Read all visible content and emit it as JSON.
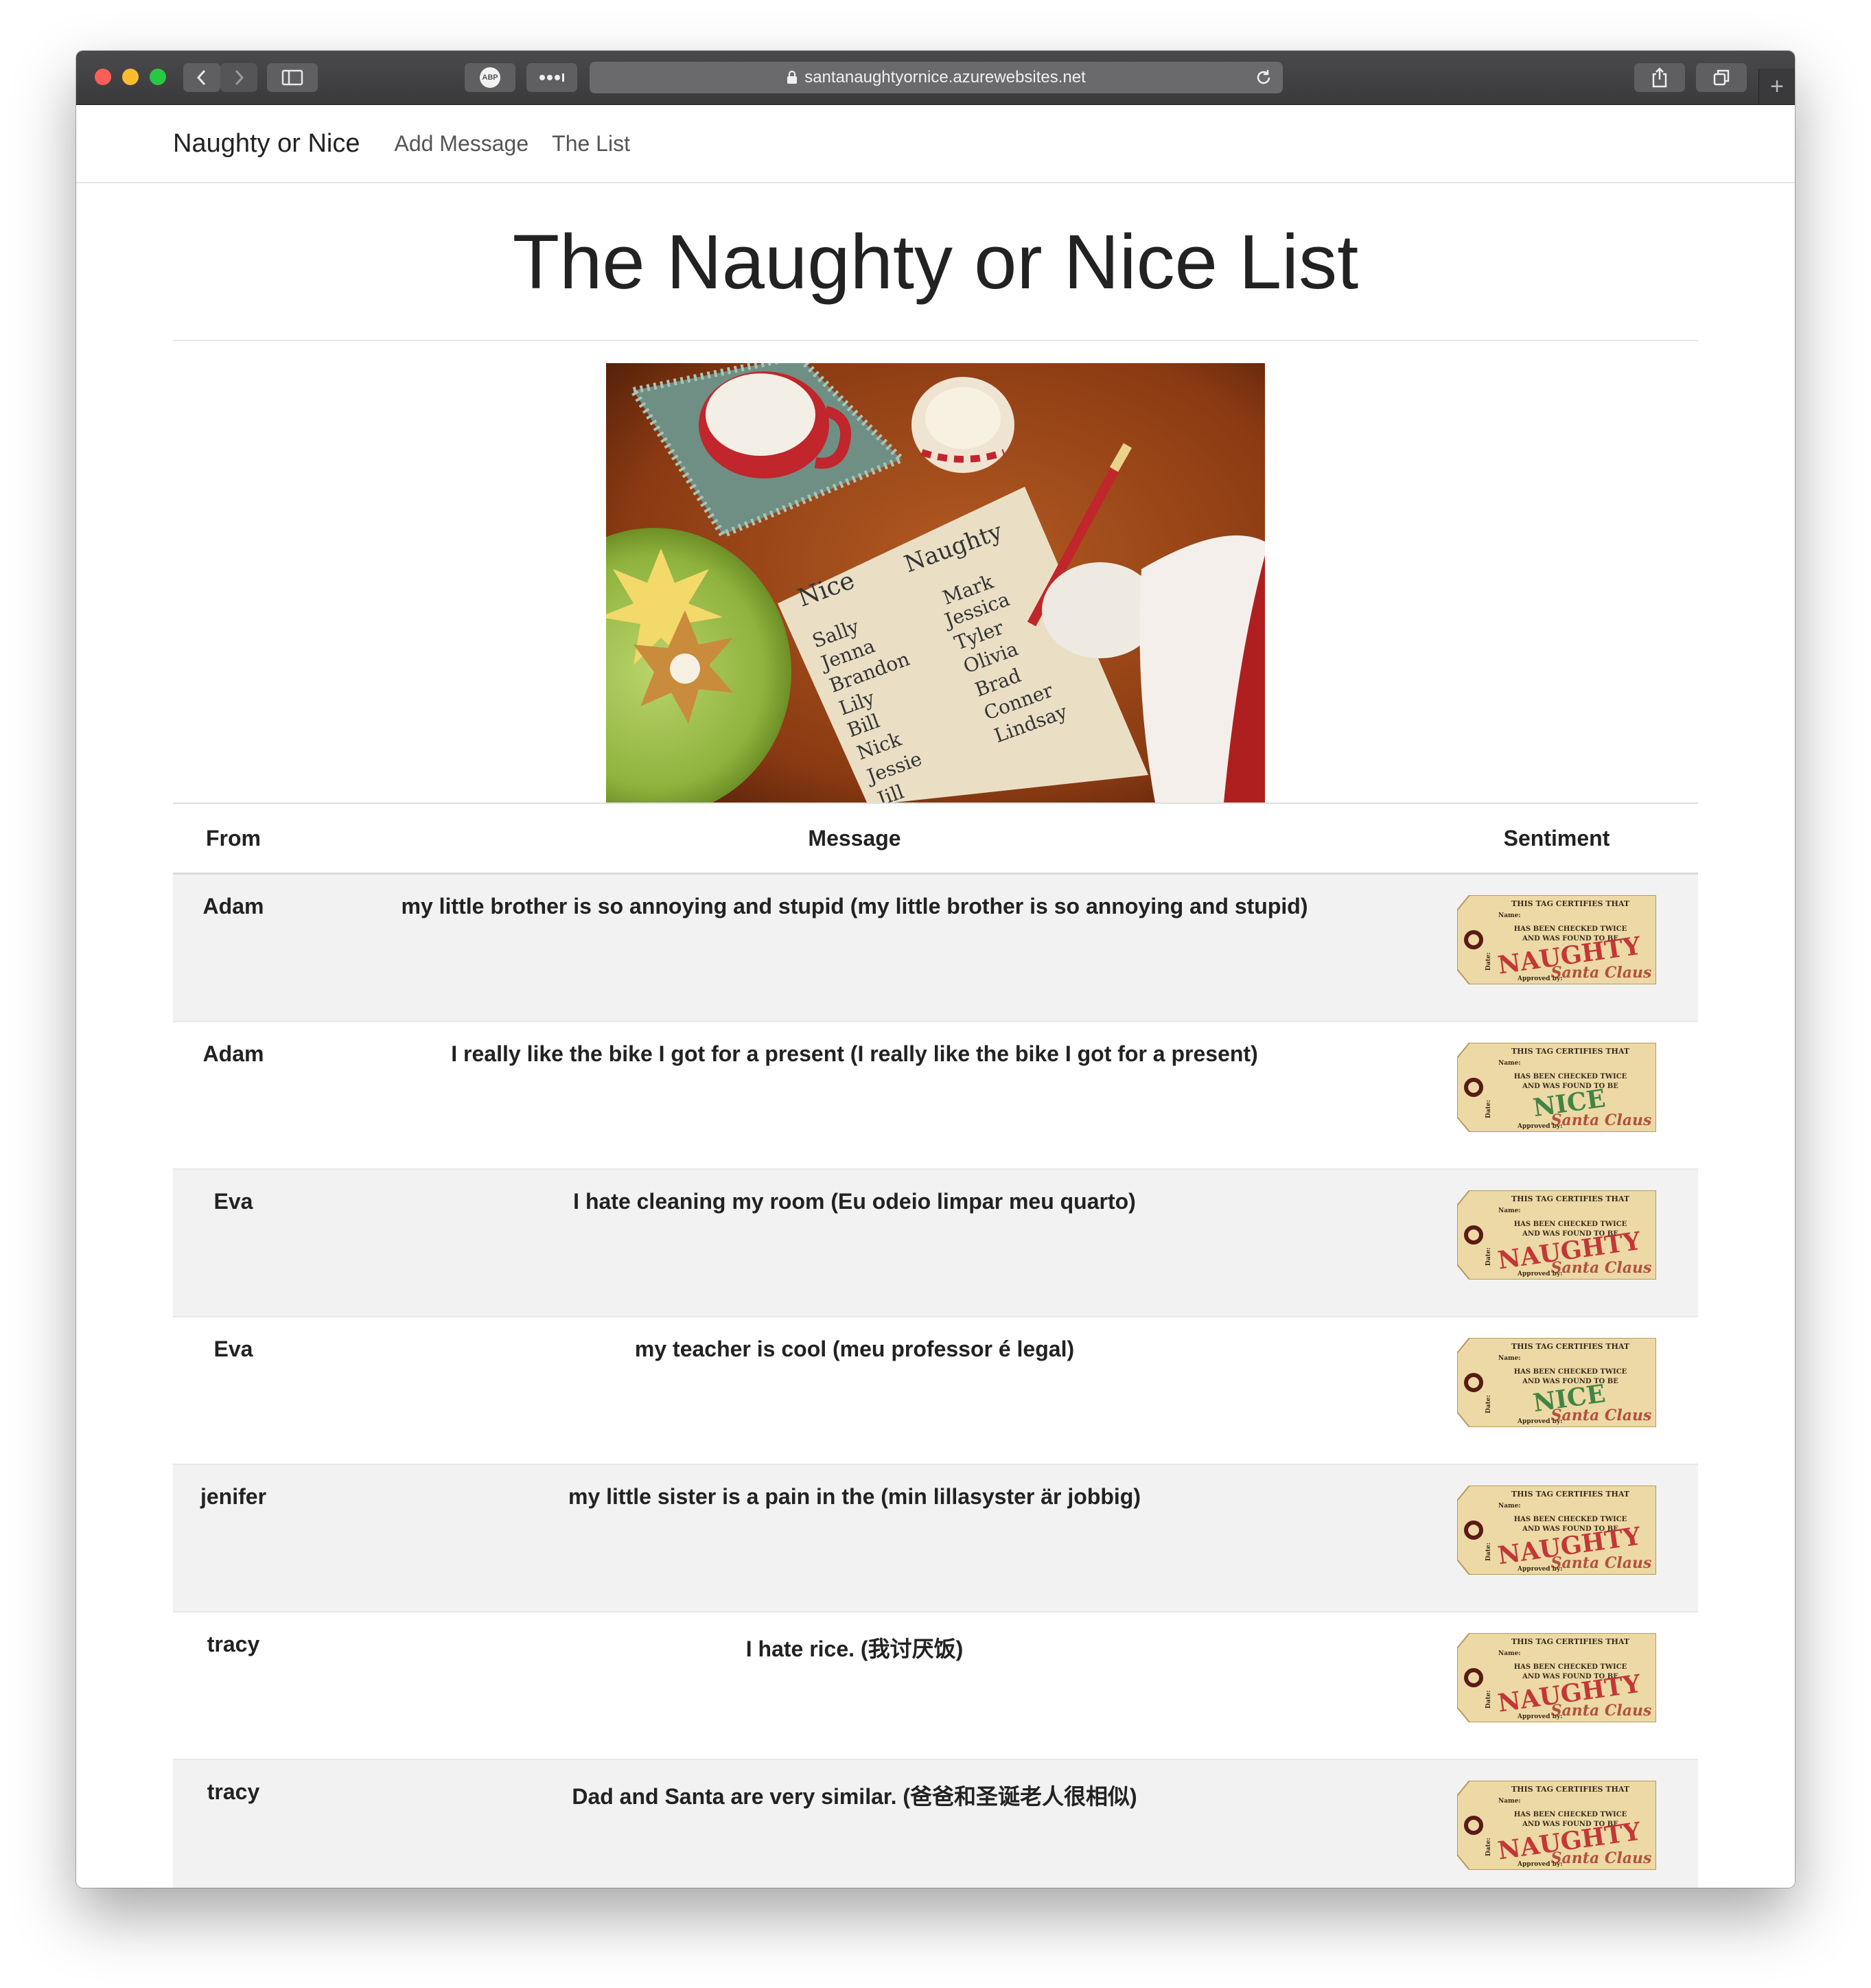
{
  "browser": {
    "url": "santanaughtyornice.azurewebsites.net",
    "abp_label": "ABP",
    "newtab_label": "+"
  },
  "nav": {
    "brand": "Naughty or Nice",
    "links": [
      "Add Message",
      "The List"
    ]
  },
  "page": {
    "title": "The Naughty or Nice List"
  },
  "photo": {
    "nice_heading": "Nice",
    "naughty_heading": "Naughty",
    "nice_names": [
      "Sally",
      "Jenna",
      "Brandon",
      "Lily",
      "Bill",
      "Nick",
      "Jessie",
      "Jill"
    ],
    "naughty_names": [
      "Mark",
      "Jessica",
      "Tyler",
      "Olivia",
      "Brad",
      "Conner",
      "Lindsay"
    ]
  },
  "table": {
    "headers": {
      "from": "From",
      "message": "Message",
      "sentiment": "Sentiment"
    },
    "rows": [
      {
        "from": "Adam",
        "message": "my little brother is so annoying and stupid (my little brother is so annoying and stupid)",
        "sentiment": "NAUGHTY"
      },
      {
        "from": "Adam",
        "message": "I really like the bike I got for a present (I really like the bike I got for a present)",
        "sentiment": "NICE"
      },
      {
        "from": "Eva",
        "message": "I hate cleaning my room (Eu odeio limpar meu quarto)",
        "sentiment": "NAUGHTY"
      },
      {
        "from": "Eva",
        "message": "my teacher is cool (meu professor é legal)",
        "sentiment": "NICE"
      },
      {
        "from": "jenifer",
        "message": "my little sister is a pain in the (min lillasyster är jobbig)",
        "sentiment": "NAUGHTY"
      },
      {
        "from": "tracy",
        "message": "I hate rice. (我讨厌饭)",
        "sentiment": "NAUGHTY"
      },
      {
        "from": "tracy",
        "message": "Dad and Santa are very similar. (爸爸和圣诞老人很相似)",
        "sentiment": "NAUGHTY"
      }
    ]
  },
  "tag": {
    "line1": "THIS TAG CERTIFIES THAT",
    "name_label": "Name:",
    "line2": "HAS BEEN CHECKED TWICE",
    "line3": "AND WAS FOUND TO BE",
    "date_label": "Date:",
    "approved_label": "Approved by:",
    "signature": "Santa Claus"
  },
  "colors": {
    "naughty": "#c0262b",
    "nice": "#2f7d3a",
    "tag_paper": "#ecd9a6"
  }
}
